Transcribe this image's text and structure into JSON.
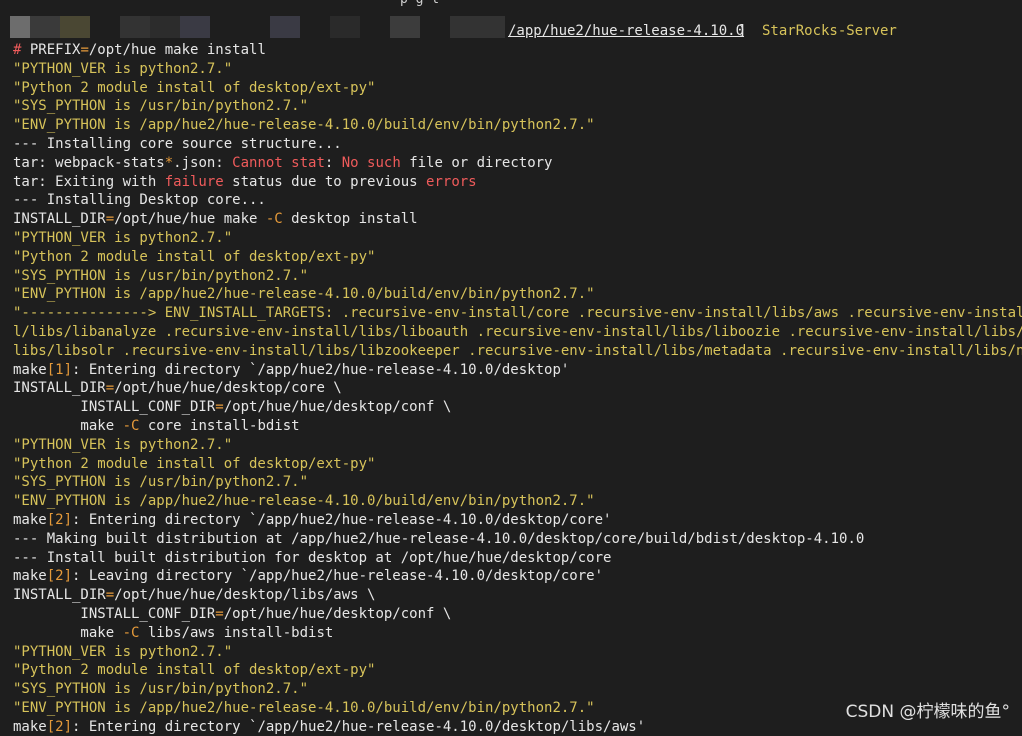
{
  "window": {
    "title_fragment": "p          g     l",
    "path": "/app/hue2/hue-release-4.10.0",
    "path_bracket": "]",
    "host": "StarRocks-Server"
  },
  "watermark": "CSDN @柠檬味的鱼°",
  "colors": {
    "background": "#1e1e1e",
    "text": "#e6e6e6",
    "yellow": "#d7c35a",
    "red": "#ef5b5b",
    "orange": "#e59a3a"
  },
  "lines": [
    [
      {
        "c": "r",
        "t": "# "
      },
      {
        "c": "w",
        "t": "PREFIX"
      },
      {
        "c": "o",
        "t": "="
      },
      {
        "c": "w",
        "t": "/opt/hue make install"
      }
    ],
    [
      {
        "c": "y",
        "t": "\"PYTHON_VER is python2.7.\""
      }
    ],
    [
      {
        "c": "y",
        "t": "\"Python 2 module install of desktop/ext-py\""
      }
    ],
    [
      {
        "c": "y",
        "t": "\"SYS_PYTHON is /usr/bin/python2.7.\""
      }
    ],
    [
      {
        "c": "y",
        "t": "\"ENV_PYTHON is /app/hue2/hue-release-4.10.0/build/env/bin/python2.7.\""
      }
    ],
    [
      {
        "c": "w",
        "t": "--- Installing core source structure..."
      }
    ],
    [
      {
        "c": "w",
        "t": "tar: webpack-stats"
      },
      {
        "c": "o",
        "t": "*"
      },
      {
        "c": "w",
        "t": ".json: "
      },
      {
        "c": "r",
        "t": "Cannot stat"
      },
      {
        "c": "w",
        "t": ": "
      },
      {
        "c": "r",
        "t": "No such"
      },
      {
        "c": "w",
        "t": " file or directory"
      }
    ],
    [
      {
        "c": "w",
        "t": "tar: Exiting with "
      },
      {
        "c": "r",
        "t": "failure"
      },
      {
        "c": "w",
        "t": " status due to previous "
      },
      {
        "c": "r",
        "t": "errors"
      }
    ],
    [
      {
        "c": "w",
        "t": "--- Installing Desktop core..."
      }
    ],
    [
      {
        "c": "w",
        "t": "INSTALL_DIR"
      },
      {
        "c": "o",
        "t": "="
      },
      {
        "c": "w",
        "t": "/opt/hue/hue make "
      },
      {
        "c": "o",
        "t": "-C"
      },
      {
        "c": "w",
        "t": " desktop install"
      }
    ],
    [
      {
        "c": "y",
        "t": "\"PYTHON_VER is python2.7.\""
      }
    ],
    [
      {
        "c": "y",
        "t": "\"Python 2 module install of desktop/ext-py\""
      }
    ],
    [
      {
        "c": "y",
        "t": "\"SYS_PYTHON is /usr/bin/python2.7.\""
      }
    ],
    [
      {
        "c": "y",
        "t": "\"ENV_PYTHON is /app/hue2/hue-release-4.10.0/build/env/bin/python2.7.\""
      }
    ],
    [
      {
        "c": "y",
        "t": "\"---------------> ENV_INSTALL_TARGETS: .recursive-env-install/core .recursive-env-install/libs/aws .recursive-env-install/"
      }
    ],
    [
      {
        "c": "y",
        "t": "l/libs/libanalyze .recursive-env-install/libs/liboauth .recursive-env-install/libs/liboozie .recursive-env-install/libs/lib"
      }
    ],
    [
      {
        "c": "y",
        "t": "libs/libsolr .recursive-env-install/libs/libzookeeper .recursive-env-install/libs/metadata .recursive-env-install/libs/note"
      }
    ],
    [
      {
        "c": "w",
        "t": "make"
      },
      {
        "c": "o",
        "t": "[1]"
      },
      {
        "c": "w",
        "t": ": Entering directory `/app/hue2/hue-release-4.10.0/desktop'"
      }
    ],
    [
      {
        "c": "w",
        "t": "INSTALL_DIR"
      },
      {
        "c": "o",
        "t": "="
      },
      {
        "c": "w",
        "t": "/opt/hue/hue/desktop/core \\"
      }
    ],
    [
      {
        "c": "w",
        "t": "        INSTALL_CONF_DIR"
      },
      {
        "c": "o",
        "t": "="
      },
      {
        "c": "w",
        "t": "/opt/hue/hue/desktop/conf \\"
      }
    ],
    [
      {
        "c": "w",
        "t": "        make "
      },
      {
        "c": "o",
        "t": "-C"
      },
      {
        "c": "w",
        "t": " core install-bdist"
      }
    ],
    [
      {
        "c": "y",
        "t": "\"PYTHON_VER is python2.7.\""
      }
    ],
    [
      {
        "c": "y",
        "t": "\"Python 2 module install of desktop/ext-py\""
      }
    ],
    [
      {
        "c": "y",
        "t": "\"SYS_PYTHON is /usr/bin/python2.7.\""
      }
    ],
    [
      {
        "c": "y",
        "t": "\"ENV_PYTHON is /app/hue2/hue-release-4.10.0/build/env/bin/python2.7.\""
      }
    ],
    [
      {
        "c": "w",
        "t": "make"
      },
      {
        "c": "o",
        "t": "[2]"
      },
      {
        "c": "w",
        "t": ": Entering directory `/app/hue2/hue-release-4.10.0/desktop/core'"
      }
    ],
    [
      {
        "c": "w",
        "t": "--- Making built distribution at /app/hue2/hue-release-4.10.0/desktop/core/build/bdist/desktop-4.10.0"
      }
    ],
    [
      {
        "c": "w",
        "t": "--- Install built distribution for desktop at /opt/hue/hue/desktop/core"
      }
    ],
    [
      {
        "c": "w",
        "t": "make"
      },
      {
        "c": "o",
        "t": "[2]"
      },
      {
        "c": "w",
        "t": ": Leaving directory `/app/hue2/hue-release-4.10.0/desktop/core'"
      }
    ],
    [
      {
        "c": "w",
        "t": "INSTALL_DIR"
      },
      {
        "c": "o",
        "t": "="
      },
      {
        "c": "w",
        "t": "/opt/hue/hue/desktop/libs/aws \\"
      }
    ],
    [
      {
        "c": "w",
        "t": "        INSTALL_CONF_DIR"
      },
      {
        "c": "o",
        "t": "="
      },
      {
        "c": "w",
        "t": "/opt/hue/hue/desktop/conf \\"
      }
    ],
    [
      {
        "c": "w",
        "t": "        make "
      },
      {
        "c": "o",
        "t": "-C"
      },
      {
        "c": "w",
        "t": " libs/aws install-bdist"
      }
    ],
    [
      {
        "c": "y",
        "t": "\"PYTHON_VER is python2.7.\""
      }
    ],
    [
      {
        "c": "y",
        "t": "\"Python 2 module install of desktop/ext-py\""
      }
    ],
    [
      {
        "c": "y",
        "t": "\"SYS_PYTHON is /usr/bin/python2.7.\""
      }
    ],
    [
      {
        "c": "y",
        "t": "\"ENV_PYTHON is /app/hue2/hue-release-4.10.0/build/env/bin/python2.7.\""
      }
    ],
    [
      {
        "c": "w",
        "t": "make"
      },
      {
        "c": "o",
        "t": "[2]"
      },
      {
        "c": "w",
        "t": ": Entering directory `/app/hue2/hue-release-4.10.0/desktop/libs/aws'"
      }
    ]
  ]
}
